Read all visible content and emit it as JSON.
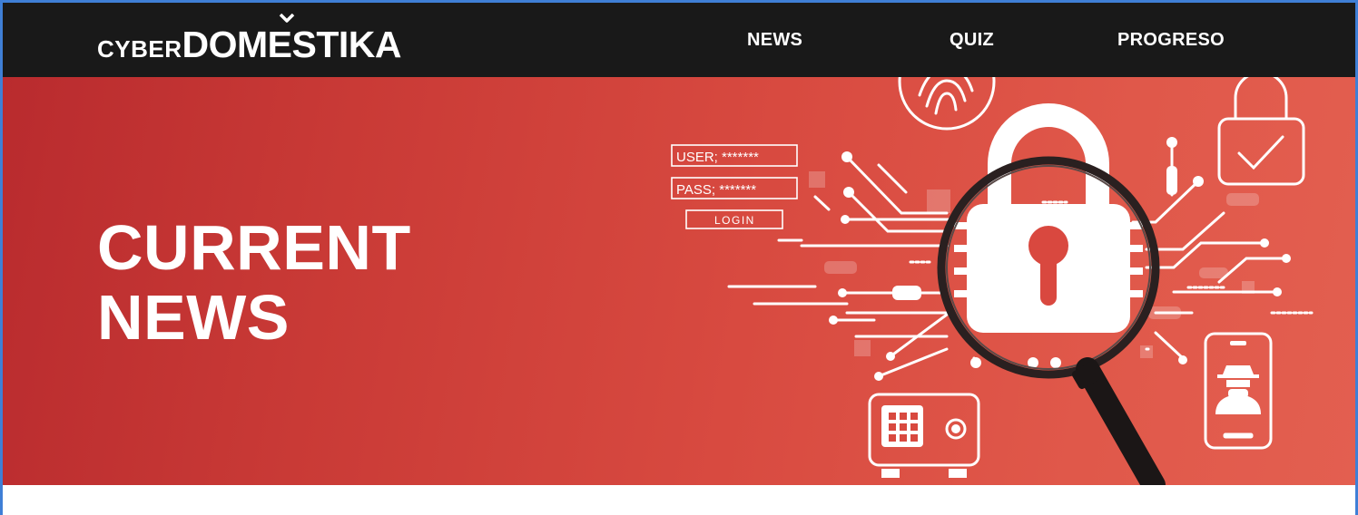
{
  "brand": {
    "prefix": "CYBER",
    "name": "DOMESTIKA"
  },
  "nav": {
    "items": [
      {
        "label": "NEWS"
      },
      {
        "label": "QUIZ"
      },
      {
        "label": "PROGRESO"
      }
    ]
  },
  "hero": {
    "title_line1": "CURRENT",
    "title_line2": "NEWS"
  },
  "illustration": {
    "user_label": "USER; *******",
    "pass_label": "PASS; *******",
    "login_label": "LOGIN"
  },
  "colors": {
    "nav_background": "#191919",
    "hero_red": "#d84a40",
    "frame_accent": "#3f7fd6",
    "text_on_dark": "#ffffff"
  },
  "icons": [
    "padlock-icon",
    "magnifier-icon",
    "fingerprint-icon",
    "lock-check-icon",
    "safe-icon",
    "smartphone-spy-icon",
    "circuit-lines"
  ]
}
